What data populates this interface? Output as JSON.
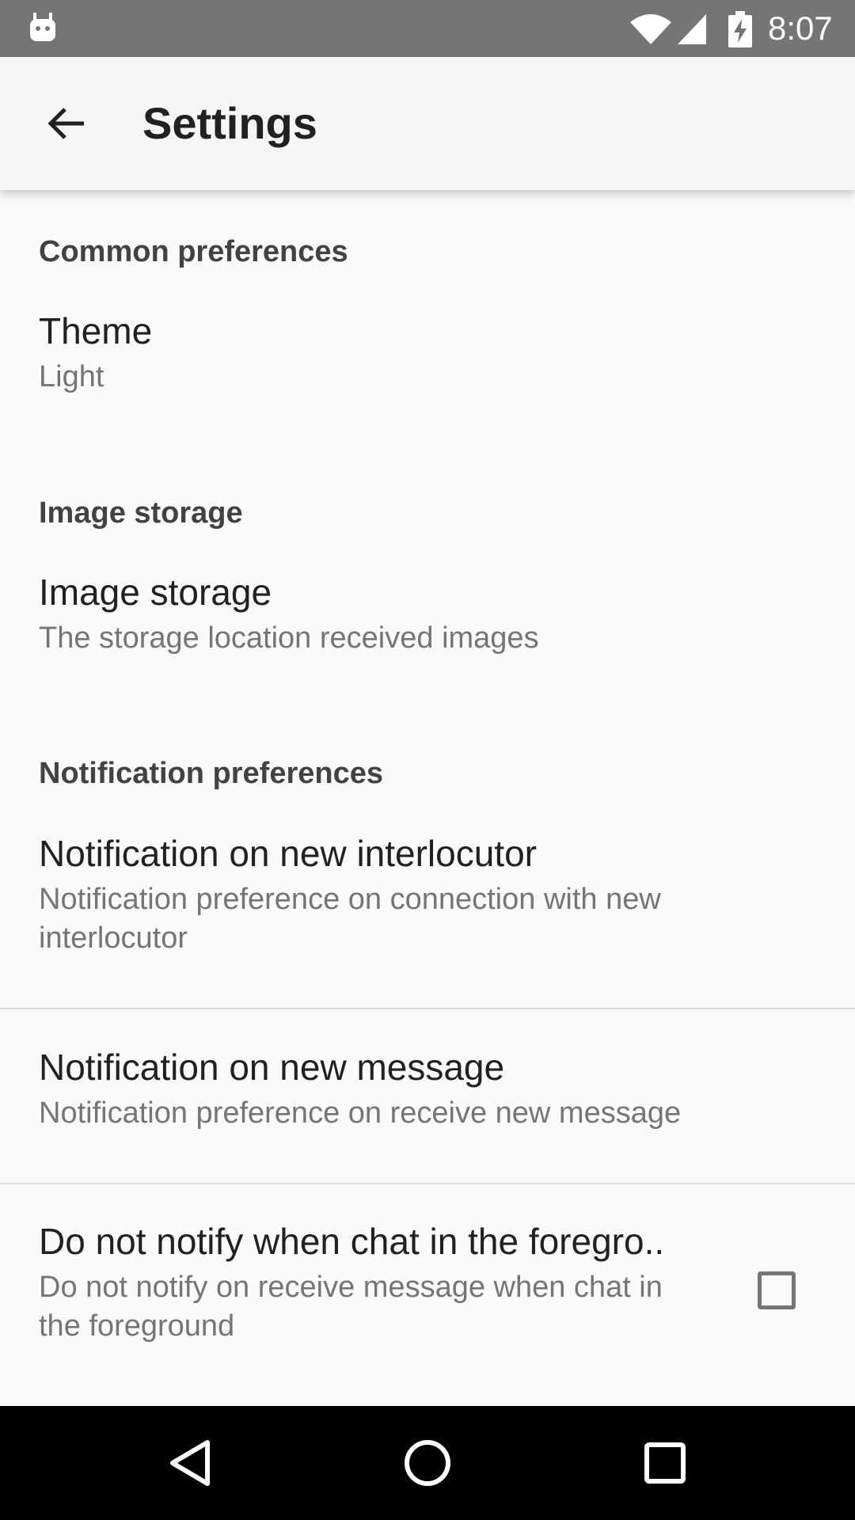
{
  "status_bar": {
    "time": "8:07",
    "icons": [
      "android-icon",
      "wifi-icon",
      "signal-icon",
      "battery-charging-icon"
    ],
    "background_color": "#757575"
  },
  "app_bar": {
    "back_icon": "arrow-back-icon",
    "title": "Settings"
  },
  "sections": [
    {
      "header": "Common preferences",
      "items": [
        {
          "title": "Theme",
          "summary": "Light"
        }
      ]
    },
    {
      "header": "Image storage",
      "items": [
        {
          "title": "Image storage",
          "summary": "The storage location received images"
        }
      ]
    },
    {
      "header": "Notification preferences",
      "items": [
        {
          "title": "Notification on new interlocutor",
          "summary": "Notification preference on connection with new interlocutor"
        },
        {
          "title": "Notification on new message",
          "summary": "Notification preference on receive new message"
        },
        {
          "title": "Do not notify when chat in the foregro..",
          "summary": "Do not notify on receive message when chat in the foreground",
          "checkbox_checked": false
        }
      ]
    }
  ],
  "nav_bar": {
    "icons": [
      "back-triangle-icon",
      "home-circle-icon",
      "recents-square-icon"
    ]
  }
}
